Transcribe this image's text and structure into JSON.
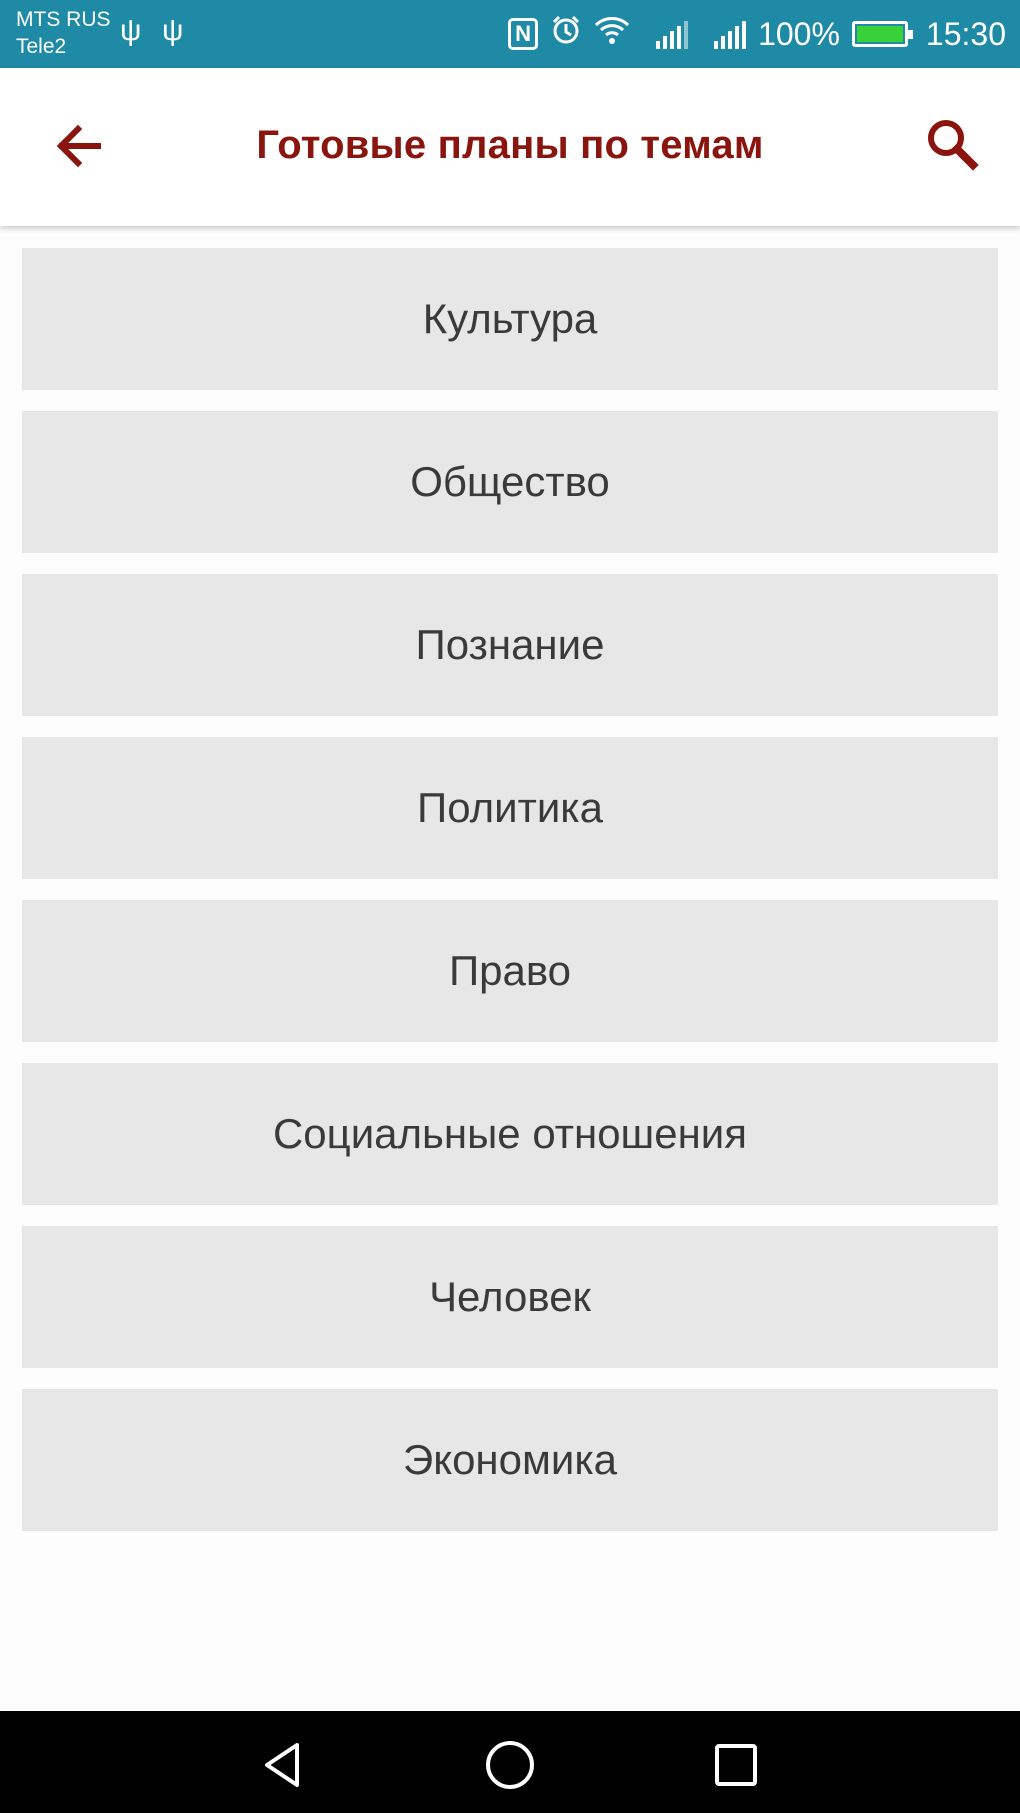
{
  "status_bar": {
    "carrier_1": "MTS RUS",
    "carrier_2": "Tele2",
    "battery": "100%",
    "time": "15:30",
    "nfc_label": "N",
    "icons": [
      "usb-icon",
      "usb-icon",
      "nfc-icon",
      "alarm-icon",
      "wifi-icon",
      "signal-icon",
      "signal-icon",
      "battery-charging-icon"
    ]
  },
  "app_bar": {
    "title": "Готовые планы по темам",
    "back_icon": "arrow-back-icon",
    "search_icon": "search-icon"
  },
  "topics": [
    "Культура",
    "Общество",
    "Познание",
    "Политика",
    "Право",
    "Социальные отношения",
    "Человек",
    "Экономика"
  ],
  "nav_bar": {
    "icons": [
      "nav-back-icon",
      "nav-home-icon",
      "nav-recents-icon"
    ]
  },
  "colors": {
    "status_bar": "#1e8aa6",
    "accent": "#8a150f",
    "item_background": "#e7e7e7",
    "item_text": "#3a3a3a",
    "battery_fill": "#39d13a"
  }
}
